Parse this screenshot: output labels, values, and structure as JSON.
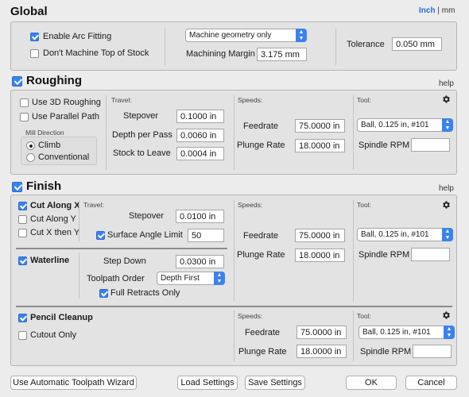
{
  "global": {
    "title": "Global",
    "unit_inch": "Inch",
    "unit_sep": "|",
    "unit_mm": "mm",
    "enable_arc_fitting": "Enable Arc Fitting",
    "dont_machine_top": "Don't Machine Top of Stock",
    "geometry_select": "Machine geometry only",
    "machining_margin_label": "Machining Margin",
    "machining_margin_value": "3.175 mm",
    "tolerance_label": "Tolerance",
    "tolerance_value": "0.050 mm"
  },
  "roughing": {
    "title": "Roughing",
    "help": "help",
    "use_3d": "Use 3D Roughing",
    "use_parallel": "Use Parallel Path",
    "mill_direction": "Mill Direction",
    "climb": "Climb",
    "conventional": "Conventional",
    "travel_label": "Travel:",
    "stepover_label": "Stepover",
    "stepover_value": "0.1000 in",
    "depth_label": "Depth per Pass",
    "depth_value": "0.0060 in",
    "stock_label": "Stock to Leave",
    "stock_value": "0.0004 in",
    "speeds_label": "Speeds:",
    "feedrate_label": "Feedrate",
    "feedrate_value": "75.0000 in",
    "plunge_label": "Plunge Rate",
    "plunge_value": "18.0000 in",
    "tool_label": "Tool:",
    "tool_value": "Ball, 0.125 in, #101",
    "spindle_label": "Spindle RPM",
    "spindle_value": ""
  },
  "finish": {
    "title": "Finish",
    "help": "help",
    "cut_x": "Cut Along X",
    "cut_y": "Cut Along Y",
    "cut_xy": "Cut X then Y",
    "travel_label": "Travel:",
    "stepover_label": "Stepover",
    "stepover_value": "0.0100 in",
    "surface_angle_label": "Surface Angle Limit",
    "surface_angle_value": "50",
    "speeds_label": "Speeds:",
    "feedrate_label": "Feedrate",
    "feedrate_value": "75.0000 in",
    "plunge_label": "Plunge Rate",
    "plunge_value": "18.0000 in",
    "tool_label": "Tool:",
    "tool_value": "Ball, 0.125 in, #101",
    "spindle_label": "Spindle RPM",
    "spindle_value": "",
    "waterline": "Waterline",
    "step_down_label": "Step Down",
    "step_down_value": "0.0300 in",
    "toolpath_order_label": "Toolpath Order",
    "toolpath_order_value": "Depth First",
    "full_retracts": "Full Retracts Only",
    "pencil_cleanup": "Pencil Cleanup",
    "cutout_only": "Cutout Only",
    "pc_speeds_label": "Speeds:",
    "pc_feedrate_label": "Feedrate",
    "pc_feedrate_value": "75.0000 in",
    "pc_plunge_label": "Plunge Rate",
    "pc_plunge_value": "18.0000 in",
    "pc_tool_label": "Tool:",
    "pc_tool_value": "Ball, 0.125 in, #101",
    "pc_spindle_label": "Spindle RPM",
    "pc_spindle_value": ""
  },
  "footer": {
    "wizard": "Use Automatic Toolpath Wizard",
    "load": "Load Settings",
    "save": "Save Settings",
    "ok": "OK",
    "cancel": "Cancel"
  },
  "colors": {
    "accent": "#3b82f0",
    "unit_active": "#2b6bd3"
  },
  "icons": [
    "gear-icon",
    "chevron-updown-icon",
    "checkbox-icon",
    "radio-icon"
  ]
}
